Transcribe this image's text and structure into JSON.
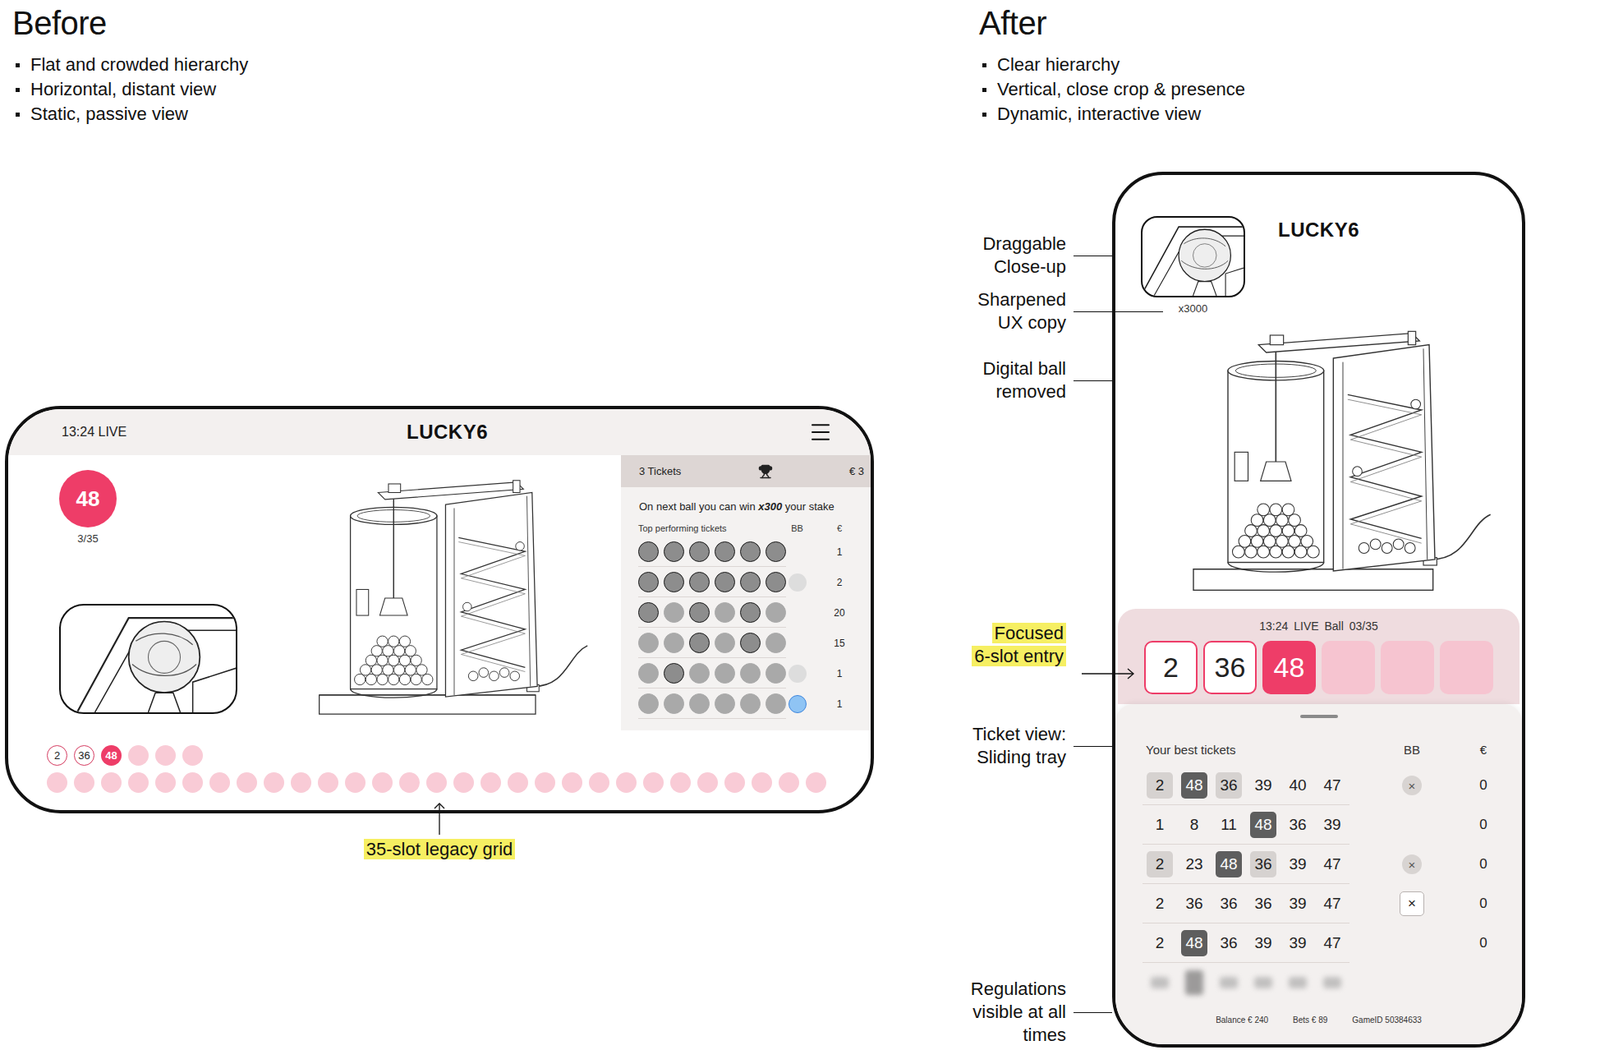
{
  "before": {
    "title": "Before",
    "points": [
      "Flat and crowded hierarchy",
      "Horizontal, distant view",
      "Static, passive view"
    ],
    "screen": {
      "time": "13:24 LIVE",
      "title": "LUCKY6",
      "ball": "48",
      "ball_count": "3/35",
      "tickets": {
        "count": "3 Tickets",
        "amount": "€ 3",
        "promo": [
          "On next ball you can win ",
          "x300",
          " your stake"
        ],
        "heading": "Top performing tickets",
        "col_bb": "BB",
        "col_amount": "€",
        "rows": [
          {
            "hits": [
              true,
              true,
              true,
              true,
              true,
              true
            ],
            "bb": "none",
            "amount": "1"
          },
          {
            "hits": [
              true,
              true,
              true,
              true,
              true,
              true
            ],
            "bb": "grey",
            "amount": "2"
          },
          {
            "hits": [
              true,
              false,
              true,
              false,
              true,
              false
            ],
            "bb": "none",
            "amount": "20"
          },
          {
            "hits": [
              false,
              false,
              true,
              false,
              true,
              false
            ],
            "bb": "none",
            "amount": "15"
          },
          {
            "hits": [
              false,
              true,
              false,
              false,
              false,
              false
            ],
            "bb": "grey",
            "amount": "1"
          },
          {
            "hits": [
              false,
              false,
              false,
              false,
              false,
              false
            ],
            "bb": "blue",
            "amount": "1"
          }
        ]
      },
      "grid": [
        [
          {
            "number": "2",
            "state": "drawn"
          },
          {
            "number": "36",
            "state": "drawn"
          },
          {
            "number": "48",
            "state": "current"
          },
          {
            "number": "",
            "state": "empty"
          },
          {
            "number": "",
            "state": "empty"
          },
          {
            "number": "",
            "state": "empty"
          }
        ],
        [
          {
            "number": "",
            "state": "empty"
          },
          {
            "number": "",
            "state": "empty"
          },
          {
            "number": "",
            "state": "empty"
          },
          {
            "number": "",
            "state": "empty"
          },
          {
            "number": "",
            "state": "empty"
          },
          {
            "number": "",
            "state": "empty"
          },
          {
            "number": "",
            "state": "empty"
          },
          {
            "number": "",
            "state": "empty"
          },
          {
            "number": "",
            "state": "empty"
          },
          {
            "number": "",
            "state": "empty"
          },
          {
            "number": "",
            "state": "empty"
          },
          {
            "number": "",
            "state": "empty"
          },
          {
            "number": "",
            "state": "empty"
          },
          {
            "number": "",
            "state": "empty"
          },
          {
            "number": "",
            "state": "empty"
          },
          {
            "number": "",
            "state": "empty"
          },
          {
            "number": "",
            "state": "empty"
          },
          {
            "number": "",
            "state": "empty"
          },
          {
            "number": "",
            "state": "empty"
          },
          {
            "number": "",
            "state": "empty"
          },
          {
            "number": "",
            "state": "empty"
          },
          {
            "number": "",
            "state": "empty"
          },
          {
            "number": "",
            "state": "empty"
          },
          {
            "number": "",
            "state": "empty"
          },
          {
            "number": "",
            "state": "empty"
          },
          {
            "number": "",
            "state": "empty"
          },
          {
            "number": "",
            "state": "empty"
          },
          {
            "number": "",
            "state": "empty"
          },
          {
            "number": "",
            "state": "empty"
          }
        ]
      ]
    },
    "note": "35-slot legacy grid"
  },
  "after": {
    "title": "After",
    "points": [
      "Clear hierarchy",
      "Vertical, close crop & presence",
      "Dynamic, interactive view"
    ],
    "screen": {
      "title": "LUCKY6",
      "multiplier": "x3000",
      "status": "13:24 LIVE Ball 03/35",
      "slots": [
        {
          "number": "2",
          "state": "drawn"
        },
        {
          "number": "36",
          "state": "drawn"
        },
        {
          "number": "48",
          "state": "current"
        },
        {
          "number": "",
          "state": "empty"
        },
        {
          "number": "",
          "state": "empty"
        },
        {
          "number": "",
          "state": "empty"
        }
      ],
      "tray": {
        "heading": "Your best tickets",
        "col_bb": "BB",
        "col_amount": "€",
        "rows": [
          {
            "numbers": [
              {
                "n": "2",
                "mark": "light"
              },
              {
                "n": "48",
                "mark": "dark"
              },
              {
                "n": "36",
                "mark": "light"
              },
              {
                "n": "39",
                "mark": "none"
              },
              {
                "n": "40",
                "mark": "none"
              },
              {
                "n": "47",
                "mark": "none"
              }
            ],
            "bb": "×",
            "bb_kind": "circle",
            "amount": "0"
          },
          {
            "numbers": [
              {
                "n": "1",
                "mark": "none"
              },
              {
                "n": "8",
                "mark": "none"
              },
              {
                "n": "11",
                "mark": "none"
              },
              {
                "n": "48",
                "mark": "dark"
              },
              {
                "n": "36",
                "mark": "none"
              },
              {
                "n": "39",
                "mark": "none"
              }
            ],
            "bb": "",
            "bb_kind": "none",
            "amount": "0"
          },
          {
            "numbers": [
              {
                "n": "2",
                "mark": "light"
              },
              {
                "n": "23",
                "mark": "none"
              },
              {
                "n": "48",
                "mark": "dark"
              },
              {
                "n": "36",
                "mark": "light"
              },
              {
                "n": "39",
                "mark": "none"
              },
              {
                "n": "47",
                "mark": "none"
              }
            ],
            "bb": "×",
            "bb_kind": "circle",
            "amount": "0"
          },
          {
            "numbers": [
              {
                "n": "2",
                "mark": "none"
              },
              {
                "n": "36",
                "mark": "none"
              },
              {
                "n": "36",
                "mark": "none"
              },
              {
                "n": "36",
                "mark": "none"
              },
              {
                "n": "39",
                "mark": "none"
              },
              {
                "n": "47",
                "mark": "none"
              }
            ],
            "bb": "×",
            "bb_kind": "box",
            "amount": "0"
          },
          {
            "numbers": [
              {
                "n": "2",
                "mark": "none"
              },
              {
                "n": "48",
                "mark": "dark"
              },
              {
                "n": "36",
                "mark": "none"
              },
              {
                "n": "39",
                "mark": "none"
              },
              {
                "n": "39",
                "mark": "none"
              },
              {
                "n": "47",
                "mark": "none"
              }
            ],
            "bb": "",
            "bb_kind": "none",
            "amount": "0"
          }
        ]
      },
      "footer": [
        "Balance € 240",
        "Bets € 89",
        "GameID 50384633"
      ]
    },
    "annotations": [
      {
        "label": [
          "Draggable",
          "Close-up"
        ],
        "kind": "line",
        "highlight": false
      },
      {
        "label": [
          "Sharpened",
          "UX copy"
        ],
        "kind": "long-line",
        "highlight": false
      },
      {
        "label": [
          "Digital ball",
          "removed"
        ],
        "kind": "line",
        "highlight": false
      },
      {
        "label": [
          "Focused",
          "6-slot entry"
        ],
        "kind": "arrow",
        "highlight": true
      },
      {
        "label": [
          "Ticket view:",
          "Sliding tray"
        ],
        "kind": "line",
        "highlight": false
      },
      {
        "label": [
          "Regulations",
          "visible at all",
          "times"
        ],
        "kind": "line",
        "highlight": false
      }
    ]
  }
}
